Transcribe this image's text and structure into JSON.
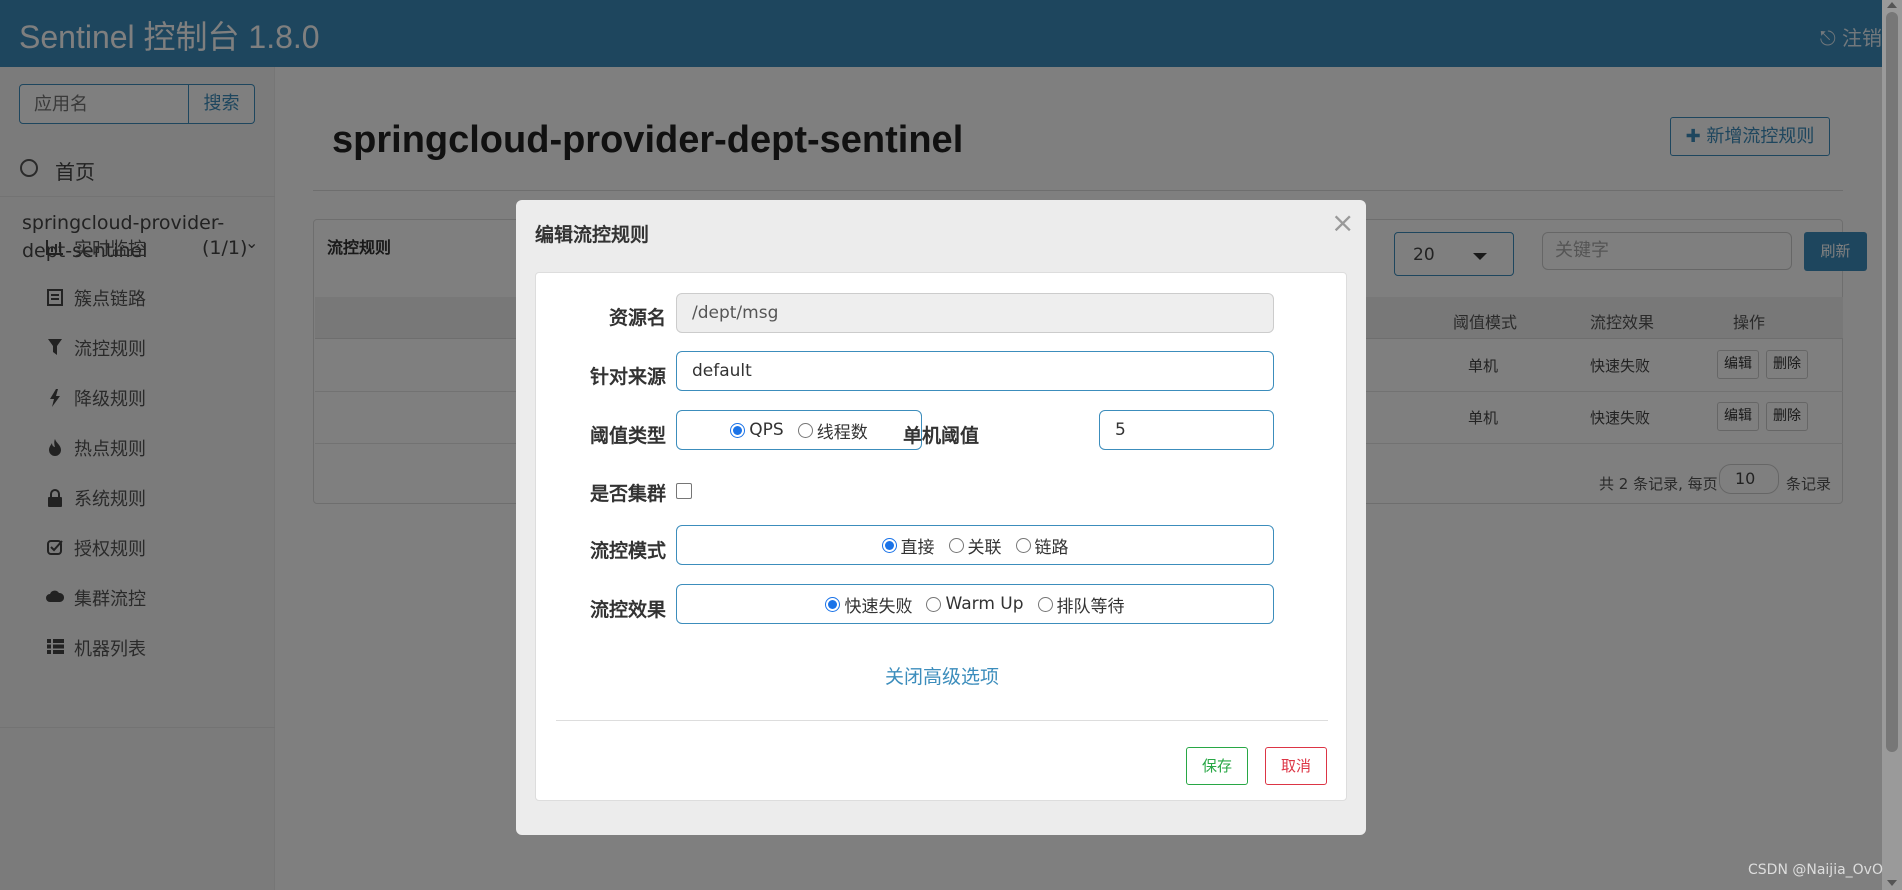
{
  "app": {
    "title": "Sentinel 控制台 1.8.0",
    "logout": "注销"
  },
  "sidebar": {
    "search_placeholder": "应用名",
    "search_button": "搜索",
    "home": "首页",
    "app_name": "springcloud-provider-dept-sentinel",
    "app_count": "(1/1)",
    "items": [
      {
        "label": "实时监控",
        "icon": "bar-chart-icon"
      },
      {
        "label": "簇点链路",
        "icon": "list-icon"
      },
      {
        "label": "流控规则",
        "icon": "filter-icon"
      },
      {
        "label": "降级规则",
        "icon": "flash-icon"
      },
      {
        "label": "热点规则",
        "icon": "fire-icon"
      },
      {
        "label": "系统规则",
        "icon": "lock-icon"
      },
      {
        "label": "授权规则",
        "icon": "check-square-icon"
      },
      {
        "label": "集群流控",
        "icon": "cloud-icon"
      },
      {
        "label": "机器列表",
        "icon": "th-list-icon"
      }
    ]
  },
  "main": {
    "page_title": "springcloud-provider-dept-sentinel",
    "add_button": "新增流控规则",
    "panel_title": "流控规则",
    "page_size_select": "20",
    "keyword_placeholder": "关键字",
    "refresh_button": "刷新",
    "columns": [
      "阈值模式",
      "流控效果",
      "操作"
    ],
    "rows": [
      {
        "threshold_mode": "单机",
        "effect": "快速失败",
        "edit": "编辑",
        "delete": "删除"
      },
      {
        "threshold_mode": "单机",
        "effect": "快速失败",
        "edit": "编辑",
        "delete": "删除"
      }
    ],
    "pager_prefix": "共 2 条记录, 每页",
    "pager_size": "10",
    "pager_suffix": "条记录"
  },
  "modal": {
    "title": "编辑流控规则",
    "close": "×",
    "resource_label": "资源名",
    "resource_value": "/dept/msg",
    "source_label": "针对来源",
    "source_value": "default",
    "threshold_type_label": "阈值类型",
    "threshold_type_options": [
      "QPS",
      "线程数"
    ],
    "threshold_type_selected": "QPS",
    "single_threshold_label": "单机阈值",
    "single_threshold_value": "5",
    "cluster_label": "是否集群",
    "cluster_checked": false,
    "mode_label": "流控模式",
    "mode_options": [
      "直接",
      "关联",
      "链路"
    ],
    "mode_selected": "直接",
    "effect_label": "流控效果",
    "effect_options": [
      "快速失败",
      "Warm Up",
      "排队等待"
    ],
    "effect_selected": "快速失败",
    "advanced_link": "关闭高级选项",
    "save_button": "保存",
    "cancel_button": "取消"
  },
  "watermark": "CSDN @Naijia_OvO",
  "colors": {
    "primary": "#3c8dbc",
    "save": "#28a745",
    "cancel": "#dc3545",
    "radio_selected": "#1a73e8"
  }
}
